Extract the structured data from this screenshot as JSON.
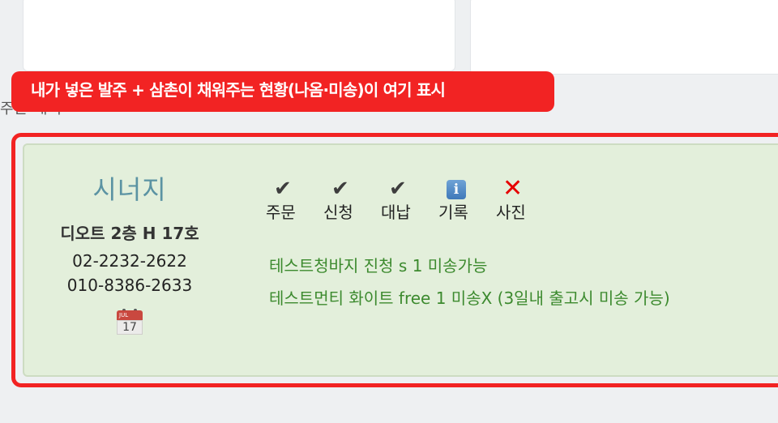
{
  "callout": {
    "text": "내가 넣은 발주 + 삼촌이 채워주는 현황(나옴·미송)이 여기 표시"
  },
  "section": {
    "label": "주문 내역"
  },
  "vendor": {
    "name": "시너지",
    "location": "디오트 2층 H 17호",
    "phones": [
      "02-2232-2622",
      "010-8386-2633"
    ],
    "calendar": {
      "month": "JUL",
      "day": "17"
    }
  },
  "statuses": [
    {
      "label": "주문",
      "icon": "check-icon",
      "state": "done"
    },
    {
      "label": "신청",
      "icon": "check-icon",
      "state": "done"
    },
    {
      "label": "대납",
      "icon": "check-icon",
      "state": "done"
    },
    {
      "label": "기록",
      "icon": "info-icon",
      "state": "info"
    },
    {
      "label": "사진",
      "icon": "cross-icon",
      "state": "missing"
    }
  ],
  "items": [
    "테스트청바지 진청 s 1 미송가능",
    "테스트먼티 화이트 free 1 미송X (3일내 출고시 미송 가능)"
  ],
  "colors": {
    "callout": "#f22323",
    "card_background": "#e3efdb",
    "vendor_name": "#5b93a3",
    "item_text": "#3c8a2e",
    "cross": "#e60000"
  }
}
